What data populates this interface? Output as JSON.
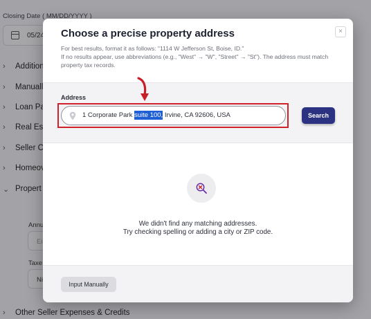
{
  "background": {
    "closing_date_label": "Closing Date ( MM/DD/YYYY )",
    "closing_date_value": "05/24",
    "sections": [
      {
        "label": "Addition"
      },
      {
        "label": "Manuall"
      },
      {
        "label": "Loan Pa"
      },
      {
        "label": "Real Est"
      },
      {
        "label": "Seller C"
      },
      {
        "label": "Homeov"
      },
      {
        "label": "Propert"
      }
    ],
    "annual_label": "Annu",
    "annual_placeholder": "Ei",
    "taxes_label": "Taxe",
    "taxes_value": "Ni",
    "bottom_section": "Other Seller Expenses & Credits"
  },
  "modal": {
    "title": "Choose a precise property address",
    "description_line1": "For best results, format it as follows: \"1114 W Jefferson St, Boise, ID.\"",
    "description_line2": "If no results appear, use abbreviations (e.g., \"West\" → \"W\", \"Street\" → \"St\"). The address must match property tax records.",
    "close_symbol": "×",
    "address_label": "Address",
    "address_before": "1 Corporate Park ",
    "address_selected": "suite 100,",
    "address_after": " Irvine, CA 92606, USA",
    "search_label": "Search",
    "empty_line1": "We didn't find any matching addresses.",
    "empty_line2": "Try checking spelling or adding a city or ZIP code.",
    "manual_button": "Input Manually"
  },
  "colors": {
    "accent": "#2c3282",
    "highlight": "#d0202a",
    "selection": "#1f5fd6"
  }
}
